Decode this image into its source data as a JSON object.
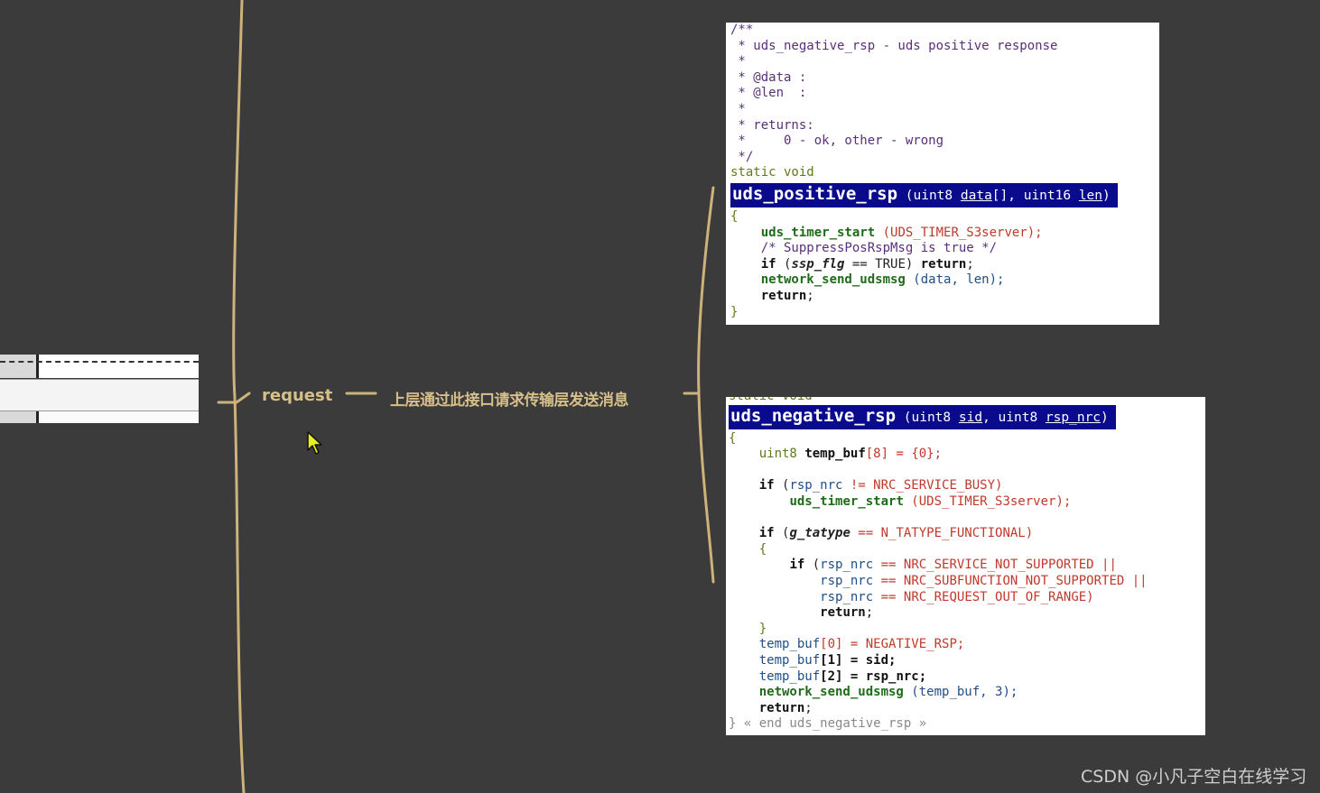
{
  "node": {
    "request": "request",
    "description": "上层通过此接口请求传输层发送消息"
  },
  "code1": {
    "comment": [
      "/**",
      " * uds_negative_rsp - uds positive response",
      " *",
      " * @data :",
      " * @len  :",
      " *",
      " * returns:",
      " *     0 - ok, other - wrong",
      " */"
    ],
    "static_void": "static void",
    "sig_name": "uds_positive_rsp",
    "sig_p1": " (uint8 ",
    "sig_p1_name": "data",
    "sig_p2": "[], uint16 ",
    "sig_p2_name": "len",
    "sig_end": ")",
    "open": "{",
    "l1_fn": "uds_timer_start",
    "l1_rest": " (UDS_TIMER_S3server);",
    "l2": "/* SuppressPosRspMsg is true */",
    "l3_kw": "if",
    "l3_var": "ssp_flg",
    "l3_rest": " == TRUE) ",
    "l3_ret": "return",
    "l4_fn": "network_send_udsmsg",
    "l4_rest": " (data, len);",
    "l5": "return",
    "close": "}"
  },
  "code2": {
    "top_clip": "static void",
    "sig_name": "uds_negative_rsp",
    "sig_p1": " (uint8 ",
    "sig_p1_name": "sid",
    "sig_p2": ", uint8 ",
    "sig_p2_name": "rsp_nrc",
    "sig_end": ")",
    "open": "{",
    "decl_type": "uint8",
    "decl_name": "temp_buf",
    "decl_rest": "[8] = {0};",
    "if1": "if",
    "if1_cond_var": "rsp_nrc",
    "if1_cond_rest": " != NRC_SERVICE_BUSY)",
    "if1_body_fn": "uds_timer_start",
    "if1_body_rest": " (UDS_TIMER_S3server);",
    "if2": "if",
    "if2_var": "g_tatype",
    "if2_rest": " == N_TATYPE_FUNCTIONAL)",
    "brace_open": "{",
    "if3": "if",
    "c1_var": "rsp_nrc",
    "c1_rest": " == NRC_SERVICE_NOT_SUPPORTED ||",
    "c2_var": "rsp_nrc",
    "c2_rest": " == NRC_SUBFUNCTION_NOT_SUPPORTED ||",
    "c3_var": "rsp_nrc",
    "c3_rest": " == NRC_REQUEST_OUT_OF_RANGE)",
    "c_ret": "return",
    "brace_close": "}",
    "a0_var": "temp_buf",
    "a0_rest": "[0] = NEGATIVE_RSP;",
    "a1_var": "temp_buf",
    "a1_rest": "[1] = sid;",
    "a2_var": "temp_buf",
    "a2_rest": "[2] = rsp_nrc;",
    "send_fn": "network_send_udsmsg",
    "send_rest": " (temp_buf, 3);",
    "ret": "return",
    "end": "} « end uds_negative_rsp »"
  },
  "watermark": "CSDN @小凡子空白在线学习"
}
